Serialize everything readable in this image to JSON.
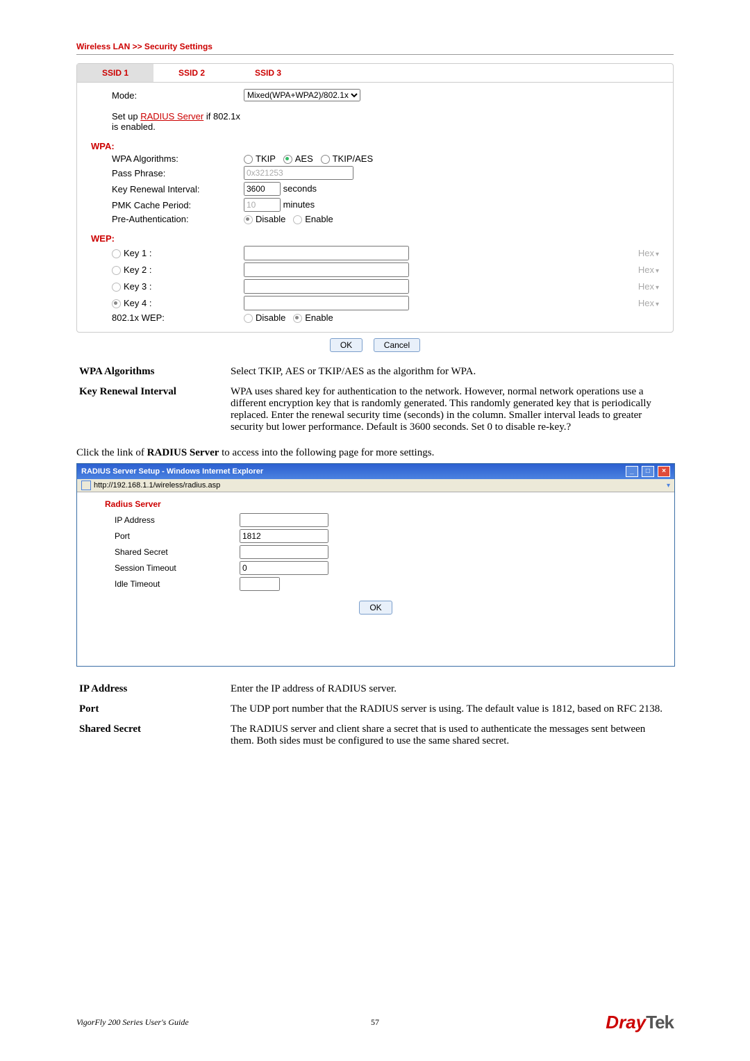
{
  "breadcrumb": "Wireless LAN >> Security Settings",
  "tabs": {
    "t1": "SSID 1",
    "t2": "SSID 2",
    "t3": "SSID 3"
  },
  "mode": {
    "label": "Mode:",
    "value": "Mixed(WPA+WPA2)/802.1x"
  },
  "radius_note_prefix": "Set up ",
  "radius_note_link": "RADIUS Server",
  "radius_note_suffix": " if 802.1x is enabled.",
  "wpa_section": "WPA:",
  "wpa": {
    "algorithms_label": "WPA Algorithms:",
    "alg_tkip": "TKIP",
    "alg_aes": "AES",
    "alg_tkipaes": "TKIP/AES",
    "pass_label": "Pass Phrase:",
    "pass_value": "0x321253",
    "renew_label": "Key Renewal Interval:",
    "renew_value": "3600",
    "renew_unit": "seconds",
    "pmk_label": "PMK Cache Period:",
    "pmk_value": "10",
    "pmk_unit": "minutes",
    "preauth_label": "Pre-Authentication:",
    "preauth_disable": "Disable",
    "preauth_enable": "Enable"
  },
  "wep_section": "WEP:",
  "wep": {
    "k1": "Key 1 :",
    "k2": "Key 2 :",
    "k3": "Key 3 :",
    "k4": "Key 4 :",
    "hex": "Hex",
    "dot1x_label": "802.1x WEP:",
    "dot1x_disable": "Disable",
    "dot1x_enable": "Enable"
  },
  "buttons": {
    "ok": "OK",
    "cancel": "Cancel"
  },
  "desc1": {
    "t1": "WPA Algorithms",
    "d1": "Select TKIP, AES or TKIP/AES as the algorithm for WPA.",
    "t2": "Key Renewal Interval",
    "d2": "WPA uses shared key for authentication to the network. However, normal network operations use a different encryption key that is randomly generated. This randomly generated key that is periodically replaced. Enter the renewal security time (seconds) in the column. Smaller interval leads to greater security but lower performance. Default is 3600 seconds. Set 0 to disable re-key.?"
  },
  "para_click_prefix": "Click the link of ",
  "para_click_bold": "RADIUS Server",
  "para_click_suffix": " to access into the following page for more settings.",
  "ie": {
    "title": "RADIUS Server Setup - Windows Internet Explorer",
    "url": "http://192.168.1.1/wireless/radius.asp"
  },
  "radius": {
    "heading": "Radius Server",
    "ip_label": "IP Address",
    "ip_value": "",
    "port_label": "Port",
    "port_value": "1812",
    "secret_label": "Shared Secret",
    "secret_value": "",
    "sess_label": "Session Timeout",
    "sess_value": "0",
    "idle_label": "Idle Timeout",
    "idle_value": "",
    "ok": "OK"
  },
  "desc2": {
    "t1": "IP Address",
    "d1": "Enter the IP address of RADIUS server.",
    "t2": "Port",
    "d2": "The UDP port number that the RADIUS server is using. The default value is 1812, based on RFC 2138.",
    "t3": "Shared Secret",
    "d3": "The RADIUS server and client share a secret that is used to authenticate the messages sent between them. Both sides must be configured to use the same shared secret."
  },
  "footer": {
    "guide": "VigorFly 200 Series User's Guide",
    "page": "57",
    "logo_dray": "Dray",
    "logo_tek": "Tek"
  }
}
